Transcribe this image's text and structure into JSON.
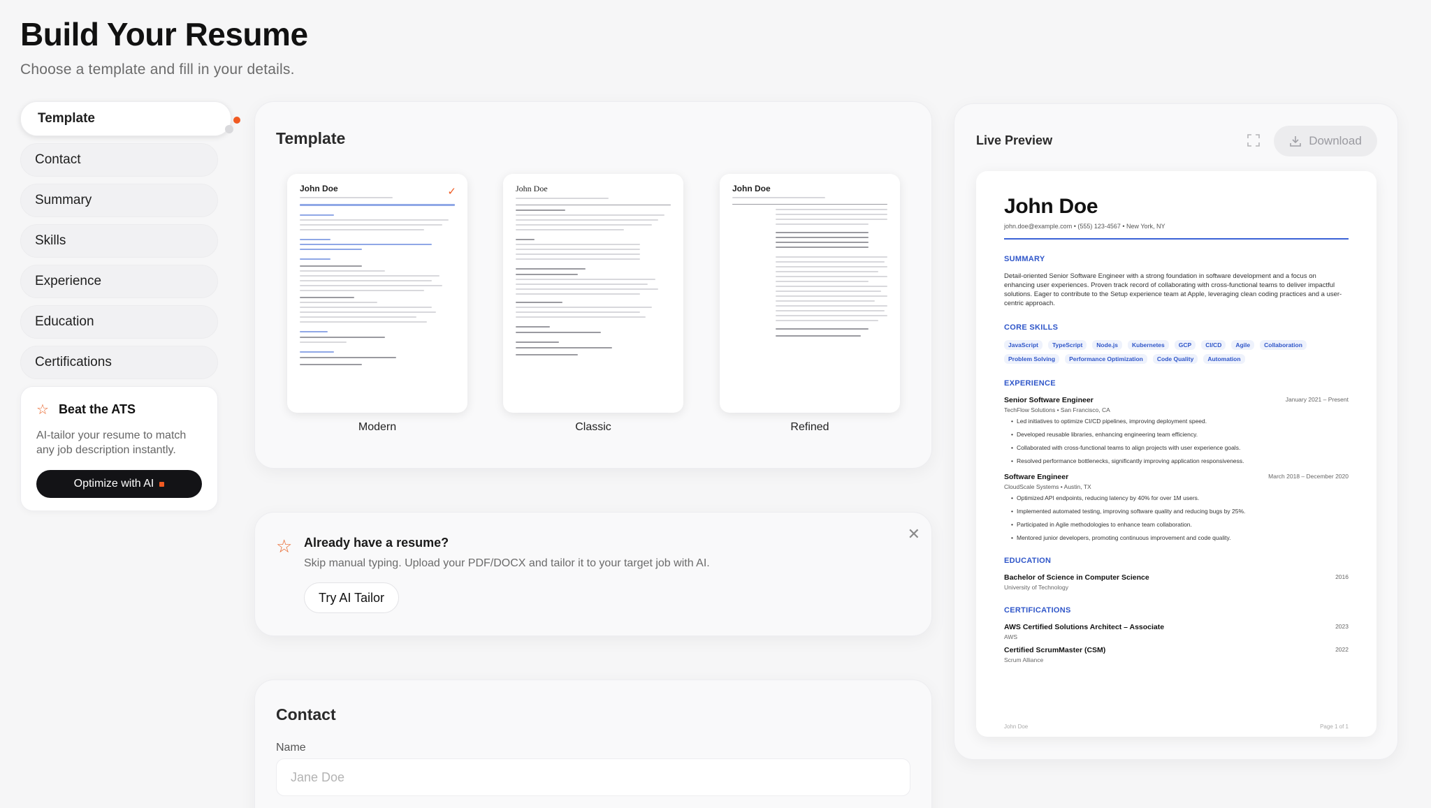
{
  "header": {
    "title": "Build Your Resume",
    "subtitle": "Choose a template and fill in your details."
  },
  "sidebar": {
    "items": [
      {
        "label": "Template",
        "active": true
      },
      {
        "label": "Contact"
      },
      {
        "label": "Summary"
      },
      {
        "label": "Skills"
      },
      {
        "label": "Experience"
      },
      {
        "label": "Education"
      },
      {
        "label": "Certifications"
      }
    ],
    "ats": {
      "title": "Beat the ATS",
      "text": "AI-tailor your resume to match any job description instantly.",
      "button": "Optimize with AI",
      "icon": "star-icon"
    }
  },
  "template_section": {
    "title": "Template",
    "templates": [
      {
        "name": "Modern",
        "selected": true,
        "preview_name": "John Doe"
      },
      {
        "name": "Classic",
        "selected": false,
        "preview_name": "John Doe"
      },
      {
        "name": "Refined",
        "selected": false,
        "preview_name": "John Doe"
      }
    ]
  },
  "upload": {
    "title": "Already have a resume?",
    "text": "Skip manual typing. Upload your PDF/DOCX and tailor it to your target job with AI.",
    "button": "Try AI Tailor",
    "icon": "star-icon"
  },
  "contact": {
    "title": "Contact",
    "name_label": "Name",
    "name_placeholder": "Jane Doe"
  },
  "preview": {
    "title": "Live Preview",
    "download": "Download",
    "resume": {
      "name": "John Doe",
      "contact": "john.doe@example.com • (555) 123-4567 • New York, NY",
      "summary_title": "SUMMARY",
      "summary": "Detail-oriented Senior Software Engineer with a strong foundation in software development and a focus on enhancing user experiences. Proven track record of collaborating with cross-functional teams to deliver impactful solutions. Eager to contribute to the Setup experience team at Apple, leveraging clean coding practices and a user-centric approach.",
      "skills_title": "CORE SKILLS",
      "skills": [
        "JavaScript",
        "TypeScript",
        "Node.js",
        "Kubernetes",
        "GCP",
        "CI/CD",
        "Agile",
        "Collaboration",
        "Problem Solving",
        "Performance Optimization",
        "Code Quality",
        "Automation"
      ],
      "experience_title": "EXPERIENCE",
      "jobs": [
        {
          "title": "Senior Software Engineer",
          "date": "January 2021 – Present",
          "company": "TechFlow Solutions • San Francisco, CA",
          "bullets": [
            "Led initiatives to optimize CI/CD pipelines, improving deployment speed.",
            "Developed reusable libraries, enhancing engineering team efficiency.",
            "Collaborated with cross-functional teams to align projects with user experience goals.",
            "Resolved performance bottlenecks, significantly improving application responsiveness."
          ]
        },
        {
          "title": "Software Engineer",
          "date": "March 2018 – December 2020",
          "company": "CloudScale Systems • Austin, TX",
          "bullets": [
            "Optimized API endpoints, reducing latency by 40% for over 1M users.",
            "Implemented automated testing, improving software quality and reducing bugs by 25%.",
            "Participated in Agile methodologies to enhance team collaboration.",
            "Mentored junior developers, promoting continuous improvement and code quality."
          ]
        }
      ],
      "education_title": "EDUCATION",
      "education": {
        "degree": "Bachelor of Science in Computer Science",
        "school": "University of Technology",
        "year": "2016"
      },
      "certifications_title": "CERTIFICATIONS",
      "certifications": [
        {
          "name": "AWS Certified Solutions Architect – Associate",
          "issuer": "AWS",
          "year": "2023"
        },
        {
          "name": "Certified ScrumMaster (CSM)",
          "issuer": "Scrum Alliance",
          "year": "2022"
        }
      ],
      "footer_left": "John Doe",
      "footer_right": "Page 1 of 1"
    }
  },
  "colors": {
    "accent": "#f05a22",
    "resume_blue": "#2f56c9",
    "dark_button": "#131316"
  }
}
